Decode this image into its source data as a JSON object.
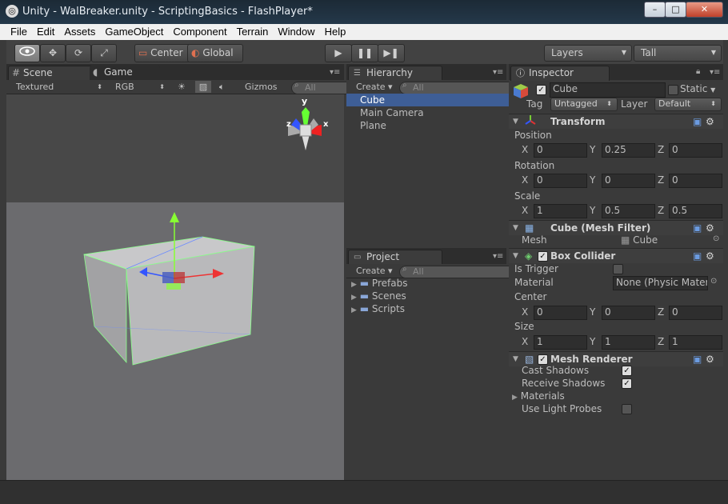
{
  "window": {
    "title": "Unity - WalBreaker.unity - ScriptingBasics - FlashPlayer*",
    "minimize": "–",
    "maximize": "□",
    "close": "✕"
  },
  "menu": [
    "File",
    "Edit",
    "Assets",
    "GameObject",
    "Component",
    "Terrain",
    "Window",
    "Help"
  ],
  "toolbar": {
    "pivot": "Center",
    "space": "Global",
    "layers": "Layers",
    "layout": "Tall",
    "play_icon": "play-icon",
    "pause_icon": "pause-icon",
    "step_icon": "step-icon"
  },
  "scene_panel": {
    "tab_scene": "Scene",
    "tab_game": "Game",
    "render_mode": "Textured",
    "color_mode": "RGB",
    "gizmos": "Gizmos",
    "search_placeholder": "All",
    "gizmo_axes": {
      "x": "x",
      "y": "y",
      "z": "z"
    }
  },
  "hierarchy": {
    "tab": "Hierarchy",
    "create": "Create",
    "search_placeholder": "All",
    "items": [
      "Cube",
      "Main Camera",
      "Plane"
    ],
    "selected": "Cube"
  },
  "project": {
    "tab": "Project",
    "create": "Create",
    "search_placeholder": "All",
    "folders": [
      "Prefabs",
      "Scenes",
      "Scripts"
    ]
  },
  "inspector": {
    "tab": "Inspector",
    "object_name": "Cube",
    "static_label": "Static",
    "tag_label": "Tag",
    "tag_value": "Untagged",
    "layer_label": "Layer",
    "layer_value": "Default",
    "transform": {
      "title": "Transform",
      "position_label": "Position",
      "position": {
        "x": "0",
        "y": "0.25",
        "z": "0"
      },
      "rotation_label": "Rotation",
      "rotation": {
        "x": "0",
        "y": "0",
        "z": "0"
      },
      "scale_label": "Scale",
      "scale": {
        "x": "1",
        "y": "0.5",
        "z": "0.5"
      }
    },
    "mesh_filter": {
      "title": "Cube (Mesh Filter)",
      "mesh_label": "Mesh",
      "mesh_value": "Cube"
    },
    "box_collider": {
      "title": "Box Collider",
      "is_trigger_label": "Is Trigger",
      "material_label": "Material",
      "material_value": "None (Physic Mater",
      "center_label": "Center",
      "center": {
        "x": "0",
        "y": "0",
        "z": "0"
      },
      "size_label": "Size",
      "size": {
        "x": "1",
        "y": "1",
        "z": "1"
      }
    },
    "mesh_renderer": {
      "title": "Mesh Renderer",
      "cast_shadows": "Cast Shadows",
      "receive_shadows": "Receive Shadows",
      "materials": "Materials",
      "use_light_probes": "Use Light Probes"
    },
    "axis_labels": {
      "x": "X",
      "y": "Y",
      "z": "Z"
    }
  }
}
